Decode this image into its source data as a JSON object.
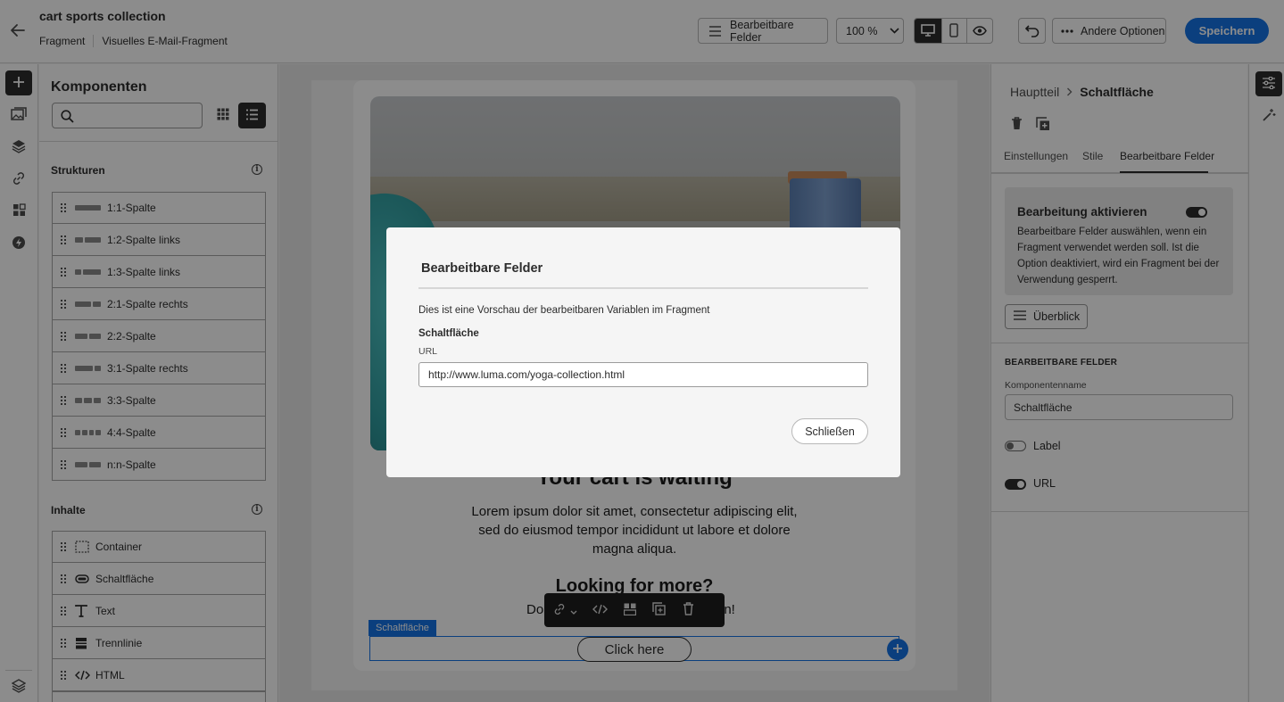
{
  "header": {
    "title": "cart sports collection",
    "breadcrumb": [
      "Fragment",
      "Visuelles E-Mail-Fragment"
    ],
    "editable_fields_label": "Bearbeitbare Felder",
    "zoom": "100 %",
    "other_options_label": "Andere Optionen",
    "save_label": "Speichern"
  },
  "components": {
    "title": "Komponenten",
    "search_placeholder": "",
    "structures_label": "Strukturen",
    "structures": [
      {
        "label": "1:1-Spalte",
        "cols": [
          1
        ]
      },
      {
        "label": "1:2-Spalte links",
        "cols": [
          1,
          2
        ]
      },
      {
        "label": "1:3-Spalte links",
        "cols": [
          1,
          3
        ]
      },
      {
        "label": "2:1-Spalte rechts",
        "cols": [
          2,
          1
        ]
      },
      {
        "label": "2:2-Spalte",
        "cols": [
          1,
          1
        ]
      },
      {
        "label": "3:1-Spalte rechts",
        "cols": [
          3,
          1
        ]
      },
      {
        "label": "3:3-Spalte",
        "cols": [
          1,
          1,
          1
        ]
      },
      {
        "label": "4:4-Spalte",
        "cols": [
          1,
          1,
          1,
          1
        ]
      },
      {
        "label": "n:n-Spalte",
        "cols": [
          1,
          1
        ]
      }
    ],
    "contents_label": "Inhalte",
    "contents": [
      {
        "label": "Container",
        "icon": "container-icon"
      },
      {
        "label": "Schaltfläche",
        "icon": "button-icon"
      },
      {
        "label": "Text",
        "icon": "text-icon"
      },
      {
        "label": "Trennlinie",
        "icon": "divider-icon"
      },
      {
        "label": "HTML",
        "icon": "html-icon"
      }
    ]
  },
  "canvas": {
    "headline": "Your cart is waiting",
    "body": "Lorem ipsum dolor sit amet, consectetur adipiscing elit, sed do eiusmod tempor incididunt ut labore et dolore magna aliqua.",
    "headline2": "Looking for more?",
    "body2_start": "Do",
    "body2_end": "on!",
    "selection_tag": "Schaltfläche",
    "button_label": "Click here"
  },
  "properties": {
    "breadcrumb_parent": "Hauptteil",
    "breadcrumb_current": "Schaltfläche",
    "tabs": [
      "Einstellungen",
      "Stile",
      "Bearbeitbare Felder"
    ],
    "active_tab": "Bearbeitbare Felder",
    "enable_title": "Bearbeitung aktivieren",
    "enable_desc": "Bearbeitbare Felder auswählen, wenn ein Fragment verwendet werden soll. Ist die Option deaktiviert, wird ein Fragment bei der Verwendung gesperrt.",
    "overview_label": "Überblick",
    "fields_heading": "BEARBEITBARE FELDER",
    "component_name_label": "Komponentenname",
    "component_name_value": "Schaltfläche",
    "label_toggle": "Label",
    "url_toggle": "URL"
  },
  "dialog": {
    "title": "Bearbeitbare Felder",
    "description": "Dies ist eine Vorschau der bearbeitbaren Variablen im Fragment",
    "section": "Schaltfläche",
    "url_label": "URL",
    "url_value": "http://www.luma.com/yoga-collection.html",
    "close_label": "Schließen"
  },
  "colors": {
    "accent": "#1473e6",
    "dark": "#2c2c2c"
  }
}
